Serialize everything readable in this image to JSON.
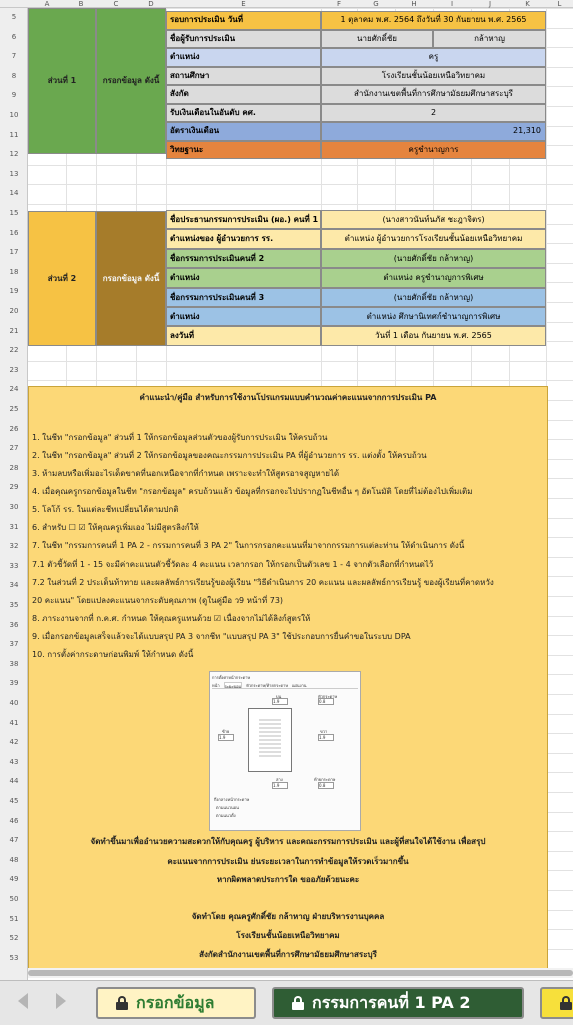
{
  "columns": [
    "A",
    "B",
    "C",
    "D",
    "E",
    "F",
    "G",
    "H",
    "I",
    "J",
    "K",
    "L"
  ],
  "rows": [
    "5",
    "6",
    "7",
    "8",
    "9",
    "10",
    "11",
    "12",
    "13",
    "14",
    "15",
    "16",
    "17",
    "18",
    "19",
    "20",
    "21",
    "22",
    "23",
    "24",
    "25",
    "26",
    "27",
    "28",
    "29",
    "30",
    "31",
    "32",
    "33",
    "34",
    "35",
    "36",
    "37",
    "38",
    "39",
    "40",
    "41",
    "42",
    "43",
    "44",
    "45",
    "46",
    "47",
    "48",
    "49",
    "50",
    "51",
    "52",
    "53"
  ],
  "section1": {
    "part": "ส่วนที่ 1",
    "fill": "กรอกข้อมูล ดังนี้",
    "rows": [
      {
        "label": "รอบการประเมิน วันที่",
        "value": "1  ตุลาคม  พ.ศ. 2564  ถึงวันที่  30  กันยายน  พ.ศ. 2565",
        "color": "#f6c244"
      },
      {
        "label": "ชื่อผู้รับการประเมิน",
        "value": "นายศักดิ์ชัย",
        "value2": "กล้าหาญ",
        "color": "#dcdcdc"
      },
      {
        "label": "ตำแหน่ง",
        "value": "ครู",
        "color": "#c9d6ef"
      },
      {
        "label": "สถานศึกษา",
        "value": "โรงเรียนชั้นน้อยเหนือวิทยาคม",
        "color": "#dcdcdc"
      },
      {
        "label": "สังกัด",
        "value": "สำนักงานเขตพื้นที่การศึกษามัธยมศึกษาสระบุรี",
        "color": "#dcdcdc"
      },
      {
        "label": "รับเงินเดือนในอันดับ คศ.",
        "value": "2",
        "color": "#dcdcdc"
      },
      {
        "label": "อัตราเงินเดือน",
        "value": "21,310",
        "color": "#8eaadb"
      },
      {
        "label": "วิทยฐานะ",
        "value": "ครูชำนาญการ",
        "color": "#e5843e"
      }
    ]
  },
  "section2": {
    "part": "ส่วนที่ 2",
    "fill": "กรอกข้อมูล ดังนี้",
    "rows": [
      {
        "label": "ชื่อประธานกรรมการประเมิน (ผอ.) คนที่ 1",
        "value": "(นางสาวนันท์นภัส ชะฎาจิตร)",
        "color": "#fde9a9"
      },
      {
        "label": "ตำแหน่งของ ผู้อำนวยการ รร.",
        "value": "ตำแหน่ง ผู้อำนวยการโรงเรียนชั้นน้อยเหนือวิทยาคม",
        "color": "#fde9a9"
      },
      {
        "label": "ชื่อกรรมการประเมินคนที่ 2",
        "value": "(นายศักดิ์ชัย  กล้าหาญ)",
        "color": "#a9d08e"
      },
      {
        "label": "ตำแหน่ง",
        "value": "ตำแหน่ง ครูชำนาญการพิเศษ",
        "color": "#a9d08e"
      },
      {
        "label": "ชื่อกรรมการประเมินคนที่ 3",
        "value": "(นายศักดิ์ชัย  กล้าหาญ)",
        "color": "#9cc2e5"
      },
      {
        "label": "ตำแหน่ง",
        "value": "ตำแหน่ง ศึกษานิเทศก์ชำนาญการพิเศษ",
        "color": "#9cc2e5"
      },
      {
        "label": "ลงวันที่",
        "value": "วันที่  1  เดือน  กันยายน  พ.ศ.  2565",
        "color": "#fde9a9"
      }
    ]
  },
  "instructions": {
    "title": "คำแนะนำ/คู่มือ  สำหรับการใช้งานโปรแกรมแบบคำนวณค่าคะแนนจากการประเมิน PA",
    "lines": [
      "1. ในชีท \"กรอกข้อมูล\" ส่วนที่ 1 ให้กรอกข้อมูลส่วนตัวของผู้รับการประเมิน ให้ครบถ้วน",
      "2. ในชีท \"กรอกข้อมูล\" ส่วนที่ 2 ให้กรอกข้อมูลของคณะกรรมการประเมิน PA ที่ผู้อำนวยการ รร. แต่งตั้ง ให้ครบถ้วน",
      "3. ห้ามลบหรือเพิ่มอะไรเด็ดขาดที่นอกเหนือจากที่กำหนด เพราะจะทำให้สูตรอาจสูญหายได้",
      "4. เมื่อคุณครูกรอกข้อมูลในชีท \"กรอกข้อมูล\" ครบถ้วนแล้ว ข้อมูลที่กรอกจะไปปรากฏในชีทอื่น ๆ อัตโนมัติ โดยที่ไม่ต้องไปเพิ่มเติม",
      "5. โลโก้ รร. ในแต่ละชีทเปลี่ยนได้ตามปกติ",
      "6. สำหรับ ☐  ☑ ให้คุณครูเพิ่มเอง ไม่มีสูตรลิงก์ให้",
      "7. ในชีท \"กรรมการคนที่ 1 PA 2 - กรรมการคนที่ 3 PA 2\" ในการกรอกคะแนนที่มาจากกรรมการแต่ละท่าน ให้ดำเนินการ ดังนี้",
      "    7.1 ตัวชี้วัดที่ 1 - 15 จะมีค่าคะแนนตัวชี้วัดละ 4 คะแนน เวลากรอก ให้กรอกเป็นตัวเลข 1 - 4 จากตัวเลือกที่กำหนดไว้",
      "    7.2 ในส่วนที่ 2 ประเด็นท้าทาย และผลลัพธ์การเรียนรู้ของผู้เรียน \"วิธีดำเนินการ 20 คะแนน และผลลัพธ์การเรียนรู้ ของผู้เรียนที่คาดหวัง",
      "20 คะแนน\" โดยแปลงคะแนนจากระดับคุณภาพ (ดูในคู่มือ ว9 หน้าที่ 73)",
      "8. ภาระงานจากที่ ก.ค.ศ. กำหนด ให้คุณครูแทนด้วย ☑ เนื่องจากไม่ได้ลิงก์สูตรให้",
      "9. เมื่อกรอกข้อมูลเสร็จแล้วจะได้แบบสรุป PA 3 จากชีท \"แบบสรุป PA 3\" ใช้ประกอบการยื่นคำขอในระบบ DPA",
      "10. การตั้งค่ากระดาษก่อนพิมพ์ ให้กำหนด ดังนี้"
    ],
    "purpose1": "จัดทำขึ้นมาเพื่ออำนวยความสะดวกให้กับคุณครู ผู้บริหาร และคณะกรรมการประเมิน และผู้ที่สนใจได้ใช้งาน เพื่อสรุป",
    "purpose2": "คะแนนจากการประเมิน ย่นระยะเวลาในการทำข้อมูลให้รวดเร็วมากขึ้น",
    "purpose3": "หากผิดพลาดประการใด ขออภัยด้วยนะคะ",
    "credit1": "จัดทำโดย คุณครูศักดิ์ชัย  กล้าหาญ ฝ่ายบริหารงานบุคคล",
    "credit2": "โรงเรียนชั้นน้อยเหนือวิทยาคม",
    "credit3": "สังกัดสำนักงานเขตพื้นที่การศึกษามัธยมศึกษาสระบุรี"
  },
  "page_setup": {
    "title": "การตั้งค่าหน้ากระดาษ",
    "tabs": [
      "หน้า",
      "ระยะขอบ",
      "หัวกระดาษ/ท้ายกระดาษ",
      "แผ่นงาน"
    ],
    "top_label": "บน",
    "top_value": "1.9",
    "header_label": "หัวกระดาษ",
    "header_value": "0.8",
    "left_label": "ซ้าย",
    "left_value": "1.9",
    "right_label": "ขวา",
    "right_value": "1.9",
    "bottom_label": "ล่าง",
    "bottom_value": "1.9",
    "footer_label": "ท้ายกระดาษ",
    "footer_value": "0.8",
    "center_label": "กึ่งกลางหน้ากระดาษ",
    "center_opt1": "ตามแนวนอน",
    "center_opt2": "ตามแนวตั้ง"
  },
  "tabs": [
    {
      "label": "กรอกข้อมูล",
      "color": "#fff3c4",
      "text_color": "#2e7d32"
    },
    {
      "label": "กรรมการคนที่ 1 PA 2",
      "color": "#2f5d34",
      "text_color": "#ffffff"
    },
    {
      "label": "",
      "color": "#f7e03b",
      "text_color": "#333333"
    }
  ]
}
